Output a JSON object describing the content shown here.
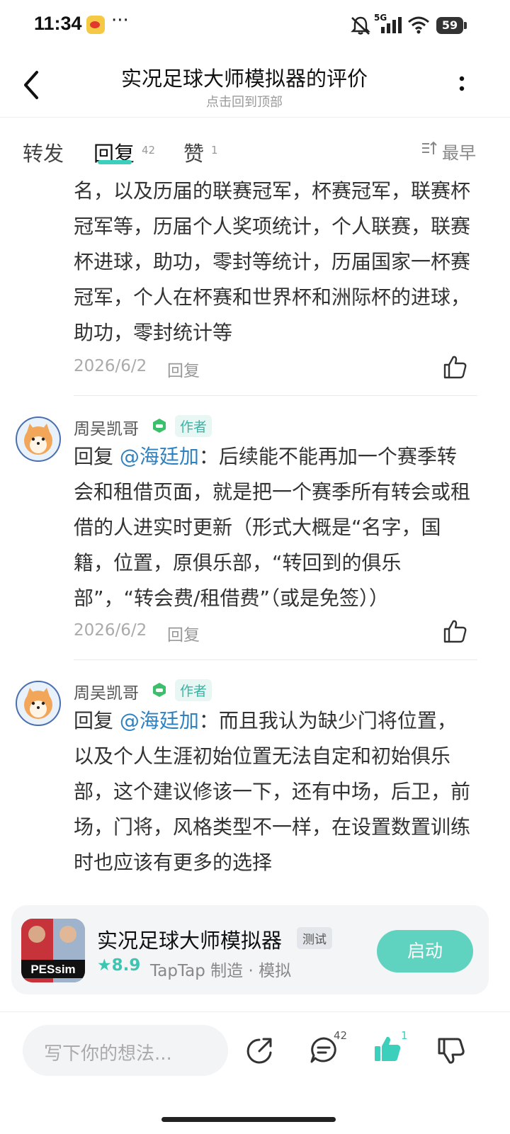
{
  "status": {
    "time": "11:34",
    "more": "···",
    "network": "5G",
    "battery": "59"
  },
  "header": {
    "title": "实况足球大师模拟器的评价",
    "subtitle": "点击回到顶部"
  },
  "tabs": [
    {
      "label": "转发",
      "count": ""
    },
    {
      "label": "回复",
      "count": "42"
    },
    {
      "label": "赞",
      "count": "1"
    }
  ],
  "sort_label": "最早",
  "comments": [
    {
      "text": "名，以及历届的联赛冠军，杯赛冠军，联赛杯冠军等，历届个人奖项统计，个人联赛，联赛杯进球，助功，零封等统计，历届国家一杯赛冠军，个人在杯赛和世界杯和洲际杯的进球，助功，零封统计等",
      "date": "2026/6/2",
      "reply": "回复"
    },
    {
      "user": "周吴凯哥",
      "tag": "作者",
      "prefix": "回复 ",
      "mention": "@海廷加",
      "text": "：后续能不能再加一个赛季转会和租借页面，就是把一个赛季所有转会或租借的人进实时更新（形式大概是“名字，国籍，位置，原俱乐部，“转回到的俱乐部”，“转会费/租借费”（或是免签））",
      "date": "2026/6/2",
      "reply": "回复"
    },
    {
      "user": "周吴凯哥",
      "tag": "作者",
      "prefix": "回复 ",
      "mention": "@海廷加",
      "text": "：而且我认为缺少门将位置，以及个人生涯初始位置无法自定和初始俱乐部，这个建议修该一下，还有中场，后卫，前场，门将，风格类型不一样，在设置数置训练时也应该有更多的选择"
    }
  ],
  "app_card": {
    "icon_text": "PESsim",
    "name": "实况足球大师模拟器",
    "tag": "测试",
    "rating": "★8.9",
    "maker": "TapTap 制造 · 模拟",
    "launch": "启动"
  },
  "bottom_bar": {
    "placeholder": "写下你的想法...",
    "comment_count": "42",
    "like_count": "1"
  },
  "colors": {
    "accent": "#3ccfbc",
    "mention": "#2f82c2",
    "author_tag": "#3bb3a3"
  }
}
